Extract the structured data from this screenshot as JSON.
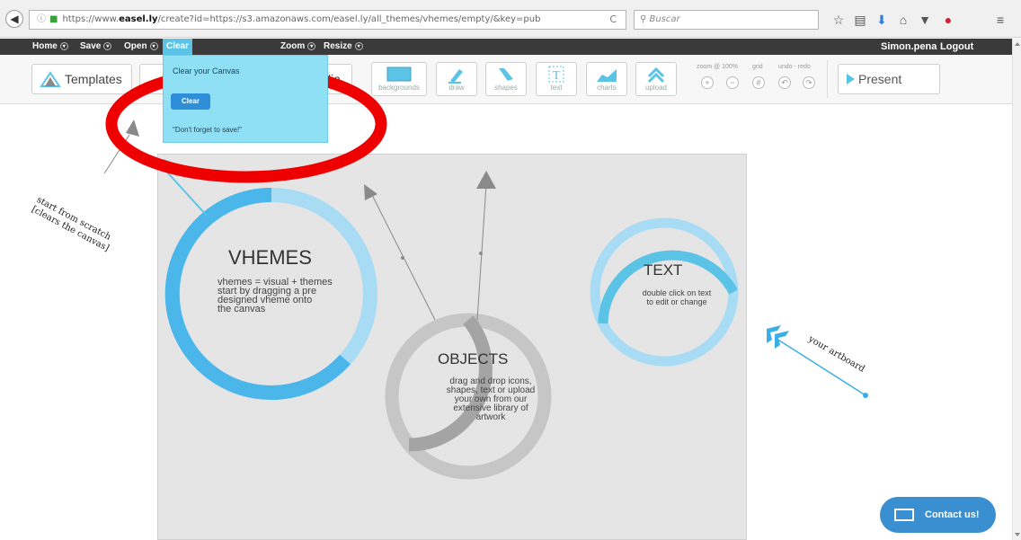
{
  "browser": {
    "url_prefix": "https://www.",
    "url_host": "easel.ly",
    "url_rest": "/create?id=https://s3.amazonaws.com/easel.ly/all_themes/vhemes/empty/&key=pub",
    "search_placeholder": "Buscar"
  },
  "nav": {
    "items": [
      "Home",
      "Save",
      "Open",
      "Clear",
      "Zoom",
      "Resize"
    ],
    "user": "Simon.pena",
    "logout": "Logout"
  },
  "toolbar": {
    "templates": "Templates",
    "media": "dia",
    "tools": [
      "backgrounds",
      "draw",
      "shapes",
      "text",
      "charts",
      "upload"
    ],
    "zoom_label": "zoom @ 100%",
    "grid_label": "grid",
    "undo_label": "undo - redo",
    "present": "Present"
  },
  "dropdown": {
    "title": "Clear your Canvas",
    "clear_btn": "Clear",
    "note": "\"Don't forget to save!\""
  },
  "canvas": {
    "vhemes_title": "VHEMES",
    "vhemes_body": [
      "vhemes = visual + themes",
      "start by dragging a pre",
      "designed vheme onto",
      "the canvas"
    ],
    "objects_title": "OBJECTS",
    "objects_body": [
      "drag and drop icons,",
      "shapes, text or upload",
      "your own from our",
      "extensive library of",
      "artwork"
    ],
    "text_title": "TEXT",
    "text_body": [
      "double click on text",
      "to edit or change"
    ]
  },
  "annotations": {
    "scratch_line1": "start from scratch",
    "scratch_line2": "[clears the canvas]",
    "artboard": "your artboard"
  },
  "contact": "Contact us!",
  "colors": {
    "accent_blue": "#5bc4e6",
    "circle_light": "#a8dcf4",
    "circle_dark": "#4ab6ea",
    "objects_gray": "#a4a4a4",
    "highlight_red": "#ee0000"
  }
}
